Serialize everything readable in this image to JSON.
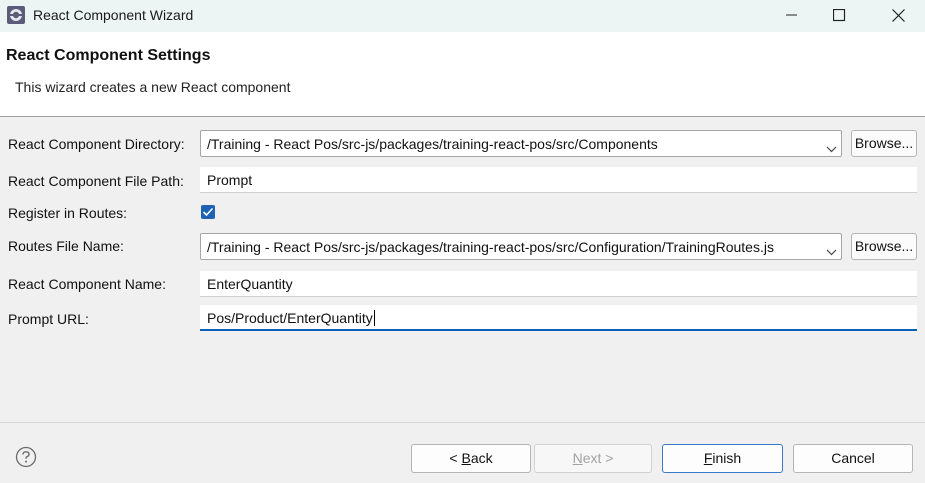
{
  "window": {
    "title": "React Component Wizard"
  },
  "header": {
    "title": "React Component Settings",
    "description": "This wizard creates a new React component"
  },
  "form": {
    "component_directory": {
      "label": "React Component Directory:",
      "value": "/Training - React Pos/src-js/packages/training-react-pos/src/Components",
      "browse_label": "Browse..."
    },
    "file_path": {
      "label": "React Component File Path:",
      "value": "Prompt"
    },
    "register_routes": {
      "label": "Register in Routes:",
      "checked": true
    },
    "routes_file": {
      "label": "Routes File Name:",
      "value": "/Training - React Pos/src-js/packages/training-react-pos/src/Configuration/TrainingRoutes.js",
      "browse_label": "Browse..."
    },
    "component_name": {
      "label": "React Component Name:",
      "value": "EnterQuantity"
    },
    "prompt_url": {
      "label": "Prompt URL:",
      "value": "Pos/Product/EnterQuantity"
    }
  },
  "footer": {
    "back_mnemonic": "B",
    "back_rest": "ack",
    "back_prefix": "< ",
    "next_mnemonic": "N",
    "next_rest": "ext >",
    "finish_mnemonic": "F",
    "finish_rest": "inish",
    "cancel_label": "Cancel"
  },
  "colors": {
    "accent": "#1e62b3",
    "titlebar": "#ecf5f4"
  }
}
